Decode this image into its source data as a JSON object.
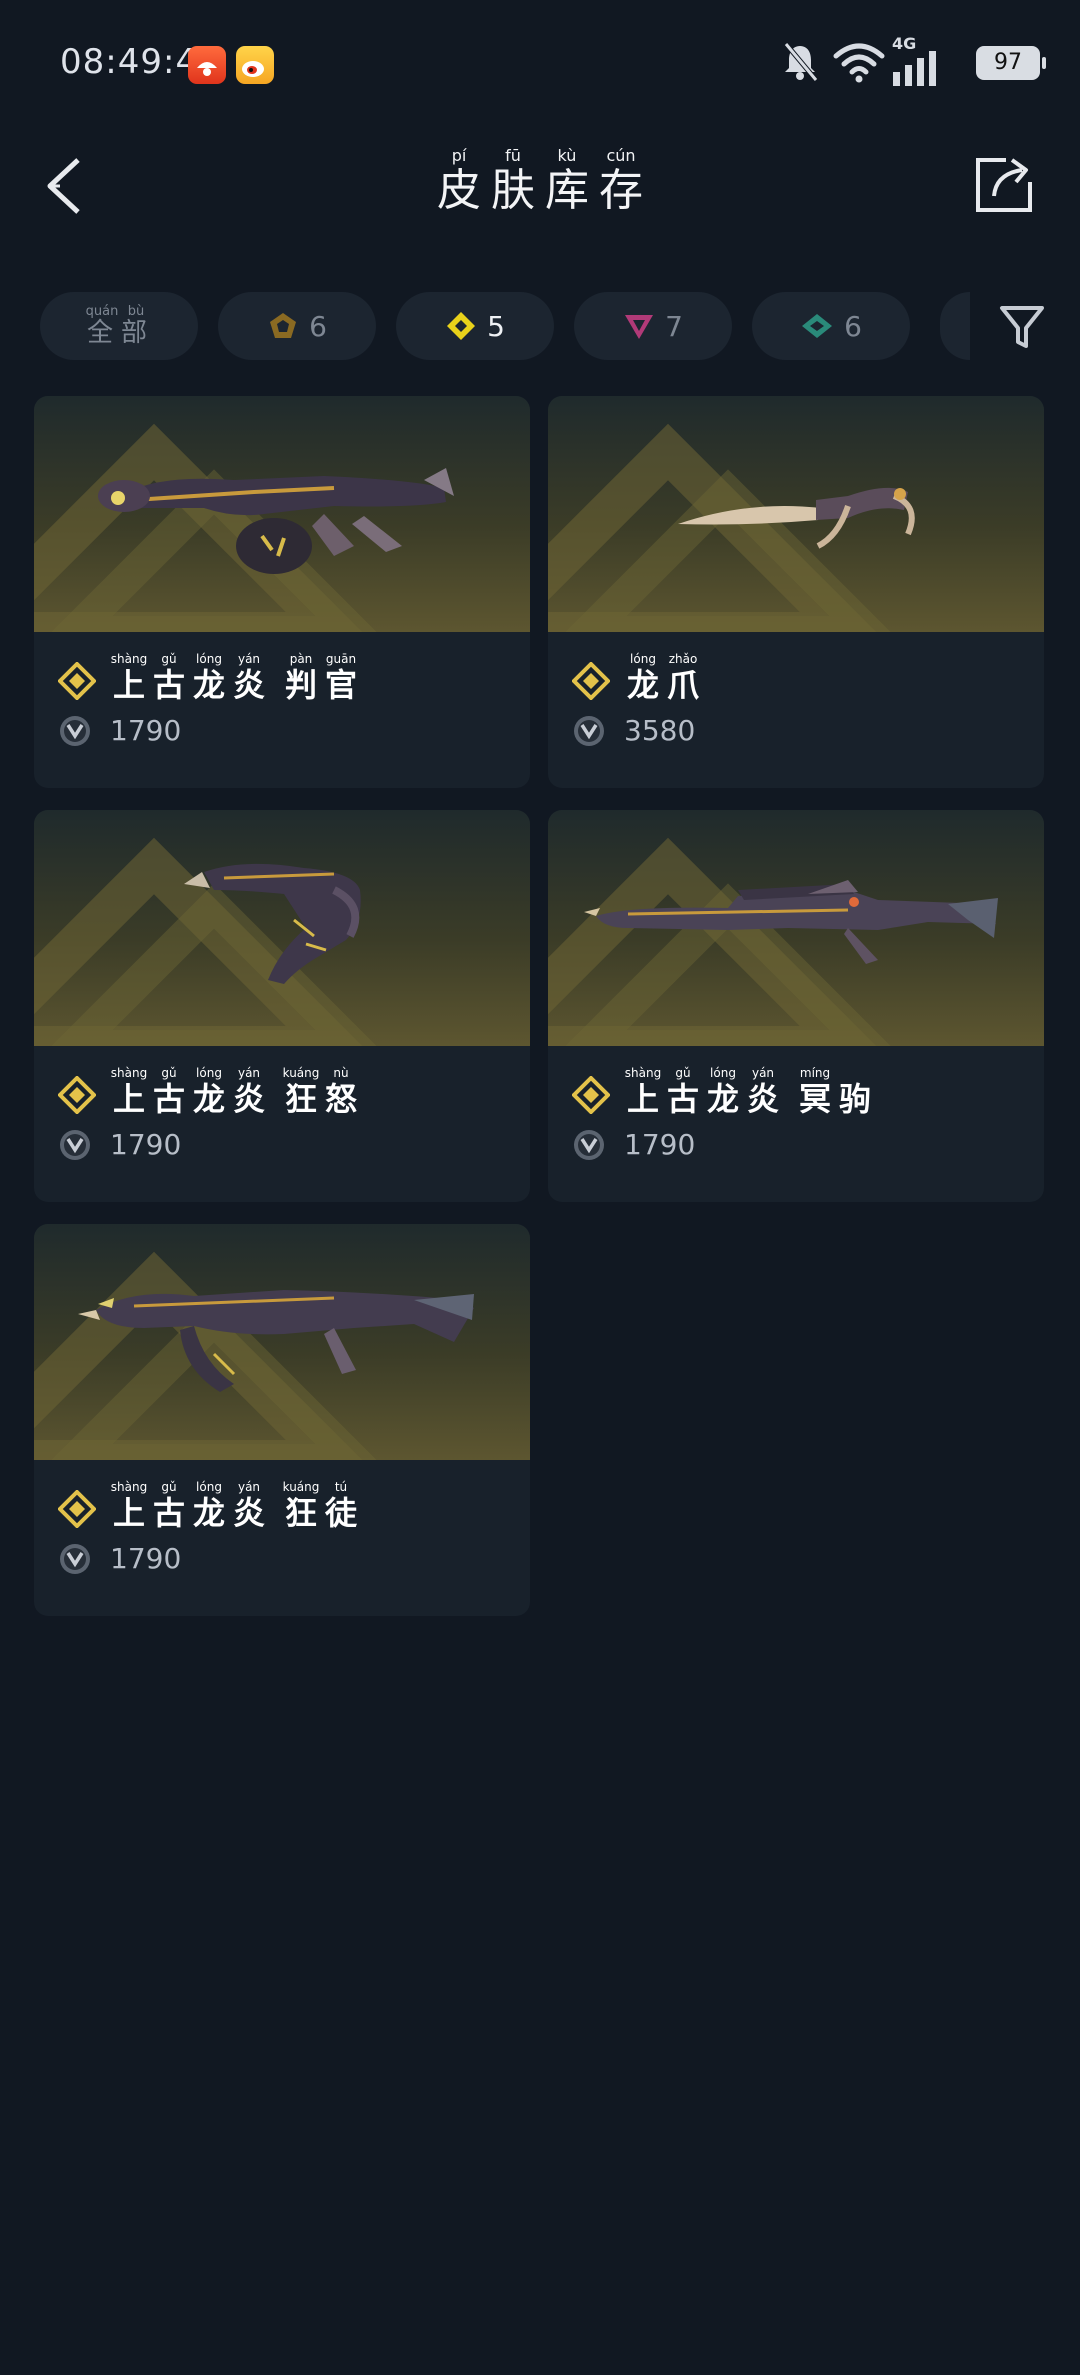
{
  "status": {
    "time": "08:49:44",
    "network": "4G",
    "battery": "97",
    "icons": [
      "pinduoduo-app-icon",
      "weibo-app-icon",
      "bell-muted-icon",
      "wifi-icon",
      "signal-icon"
    ]
  },
  "header": {
    "title": [
      {
        "py": "pí",
        "hz": "皮"
      },
      {
        "py": "fū",
        "hz": "肤"
      },
      {
        "py": "kù",
        "hz": "库"
      },
      {
        "py": "cún",
        "hz": "存"
      }
    ],
    "back_icon": "chevron-left-icon",
    "share_icon": "share-icon"
  },
  "filters": {
    "all": [
      {
        "py": "quán",
        "hz": "全"
      },
      {
        "py": "bù",
        "hz": "部"
      }
    ],
    "tiers": [
      {
        "count": "6",
        "icon": "tier-select-icon",
        "color": "#8a6a22"
      },
      {
        "count": "5",
        "icon": "tier-deluxe-icon",
        "color": "#e9d21a"
      },
      {
        "count": "7",
        "icon": "tier-premium-icon",
        "color": "#b13a78"
      },
      {
        "count": "6",
        "icon": "tier-exclusive-icon",
        "color": "#2a8a7a"
      }
    ],
    "filter_icon": "filter-icon"
  },
  "cards": [
    {
      "name": [
        {
          "py": "shàng",
          "hz": "上"
        },
        {
          "py": "gǔ",
          "hz": "古"
        },
        {
          "py": "lóng",
          "hz": "龙"
        },
        {
          "py": "yán",
          "hz": "炎"
        },
        {
          "py": "pàn",
          "hz": "判"
        },
        {
          "py": "guān",
          "hz": "官"
        }
      ],
      "price": "1790",
      "weapon": "shotgun"
    },
    {
      "name": [
        {
          "py": "lóng",
          "hz": "龙"
        },
        {
          "py": "zhǎo",
          "hz": "爪"
        }
      ],
      "price": "3580",
      "weapon": "knife"
    },
    {
      "name": [
        {
          "py": "shàng",
          "hz": "上"
        },
        {
          "py": "gǔ",
          "hz": "古"
        },
        {
          "py": "lóng",
          "hz": "龙"
        },
        {
          "py": "yán",
          "hz": "炎"
        },
        {
          "py": "kuáng",
          "hz": "狂"
        },
        {
          "py": "nù",
          "hz": "怒"
        }
      ],
      "price": "1790",
      "weapon": "pistol"
    },
    {
      "name": [
        {
          "py": "shàng",
          "hz": "上"
        },
        {
          "py": "gǔ",
          "hz": "古"
        },
        {
          "py": "lóng",
          "hz": "龙"
        },
        {
          "py": "yán",
          "hz": "炎"
        },
        {
          "py": "míng",
          "hz": "冥"
        },
        {
          "py": "",
          "hz": "驹"
        }
      ],
      "price": "1790",
      "weapon": "sniper"
    },
    {
      "name": [
        {
          "py": "shàng",
          "hz": "上"
        },
        {
          "py": "gǔ",
          "hz": "古"
        },
        {
          "py": "lóng",
          "hz": "龙"
        },
        {
          "py": "yán",
          "hz": "炎"
        },
        {
          "py": "kuáng",
          "hz": "狂"
        },
        {
          "py": "tú",
          "hz": "徒"
        }
      ],
      "price": "1790",
      "weapon": "rifle"
    }
  ],
  "colors": {
    "background": "#111822",
    "card": "#18212b",
    "chip": "#1c2530",
    "tier_deluxe": "#e3c24a"
  }
}
